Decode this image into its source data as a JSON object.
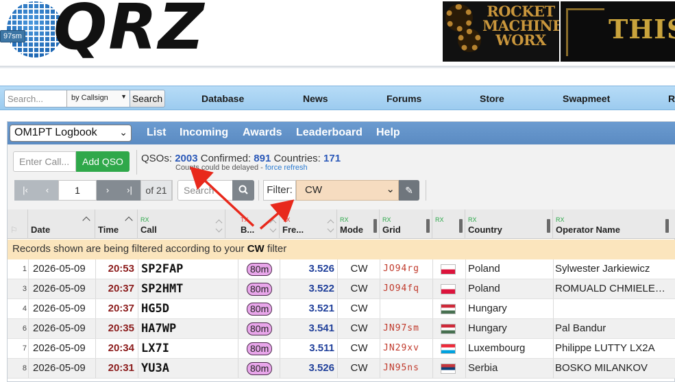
{
  "header": {
    "logo_text": "QRZ",
    "grid_tag": "97sm",
    "ad1_text": "ROCKET MACHINE WORX",
    "ad2_text": "THIS"
  },
  "navbar": {
    "search_placeholder": "Search...",
    "search_by": "by Callsign",
    "search_button": "Search",
    "items": [
      "Database",
      "News",
      "Forums",
      "Store",
      "Swapmeet",
      "R"
    ]
  },
  "logbook": {
    "selected_book": "OM1PT Logbook",
    "tabs": [
      "List",
      "Incoming",
      "Awards",
      "Leaderboard",
      "Help"
    ],
    "enter_call_placeholder": "Enter Call...",
    "add_qso_label": "Add QSO",
    "stats": {
      "qsos_label": "QSOs:",
      "qsos": "2003",
      "confirmed_label": "Confirmed:",
      "confirmed": "891",
      "countries_label": "Countries:",
      "countries": "171",
      "note": "Counts could be delayed - ",
      "refresh_link": "force refresh"
    },
    "pager": {
      "first": "|‹",
      "prev": "‹",
      "page": "1",
      "next": "›",
      "last": "›|",
      "of_label": "of 21"
    },
    "search_placeholder": "Search",
    "filter_label": "Filter:",
    "filter_value": "CW",
    "banner": {
      "prefix": "Records shown are being filtered according to your ",
      "filter": "CW",
      "suffix": " filter"
    }
  },
  "table": {
    "columns": [
      {
        "key": "flag",
        "label": "",
        "tag": ""
      },
      {
        "key": "date",
        "label": "Date",
        "tag": ""
      },
      {
        "key": "time",
        "label": "Time",
        "tag": ""
      },
      {
        "key": "call",
        "label": "Call",
        "tag": "RX"
      },
      {
        "key": "band",
        "label": "B...",
        "tag": "TX"
      },
      {
        "key": "freq",
        "label": "Fre...",
        "tag": "TX"
      },
      {
        "key": "mode",
        "label": "Mode",
        "tag": "RX"
      },
      {
        "key": "grid",
        "label": "Grid",
        "tag": "RX"
      },
      {
        "key": "dxcc",
        "label": "",
        "tag": "RX"
      },
      {
        "key": "country",
        "label": "Country",
        "tag": "RX"
      },
      {
        "key": "operator",
        "label": "Operator Name",
        "tag": "RX"
      }
    ],
    "rows": [
      {
        "num": "1",
        "date": "2026-05-09",
        "time": "20:53",
        "call": "SP2FAP",
        "band": "80m",
        "freq": "3.526",
        "mode": "CW",
        "grid": "JO94rg",
        "country": "Poland",
        "operator": "Sylwester Jarkiewicz",
        "flag": "poland"
      },
      {
        "num": "3",
        "date": "2026-05-09",
        "time": "20:37",
        "call": "SP2HMT",
        "band": "80m",
        "freq": "3.522",
        "mode": "CW",
        "grid": "JO94fq",
        "country": "Poland",
        "operator": "ROMUALD CHMIELEWSKI",
        "flag": "poland"
      },
      {
        "num": "4",
        "date": "2026-05-09",
        "time": "20:37",
        "call": "HG5D",
        "band": "80m",
        "freq": "3.521",
        "mode": "CW",
        "grid": "",
        "country": "Hungary",
        "operator": "",
        "flag": "hungary"
      },
      {
        "num": "6",
        "date": "2026-05-09",
        "time": "20:35",
        "call": "HA7WP",
        "band": "80m",
        "freq": "3.541",
        "mode": "CW",
        "grid": "JN97sm",
        "country": "Hungary",
        "operator": "Pal Bandur",
        "flag": "hungary"
      },
      {
        "num": "7",
        "date": "2026-05-09",
        "time": "20:34",
        "call": "LX7I",
        "band": "80m",
        "freq": "3.511",
        "mode": "CW",
        "grid": "JN29xv",
        "country": "Luxembourg",
        "operator": "Philippe LUTTY LX2A",
        "flag": "luxembourg"
      },
      {
        "num": "8",
        "date": "2026-05-09",
        "time": "20:31",
        "call": "YU3A",
        "band": "80m",
        "freq": "3.526",
        "mode": "CW",
        "grid": "JN95ns",
        "country": "Serbia",
        "operator": "BOSKO MILANKOV",
        "flag": "serbia"
      }
    ]
  },
  "colors": {
    "nav_bg": "#a9d3f3",
    "logbook_bar": "#6393c9",
    "add_qso": "#2fa84a",
    "filter_bg": "#f6dcc0",
    "banner_bg": "#fbe5bd",
    "time_color": "#8b1b1b",
    "freq_color": "#1f3f9a",
    "grid_color": "#c0392b",
    "band_pill": "#e8a6ea",
    "arrow_red": "#e8291c"
  }
}
